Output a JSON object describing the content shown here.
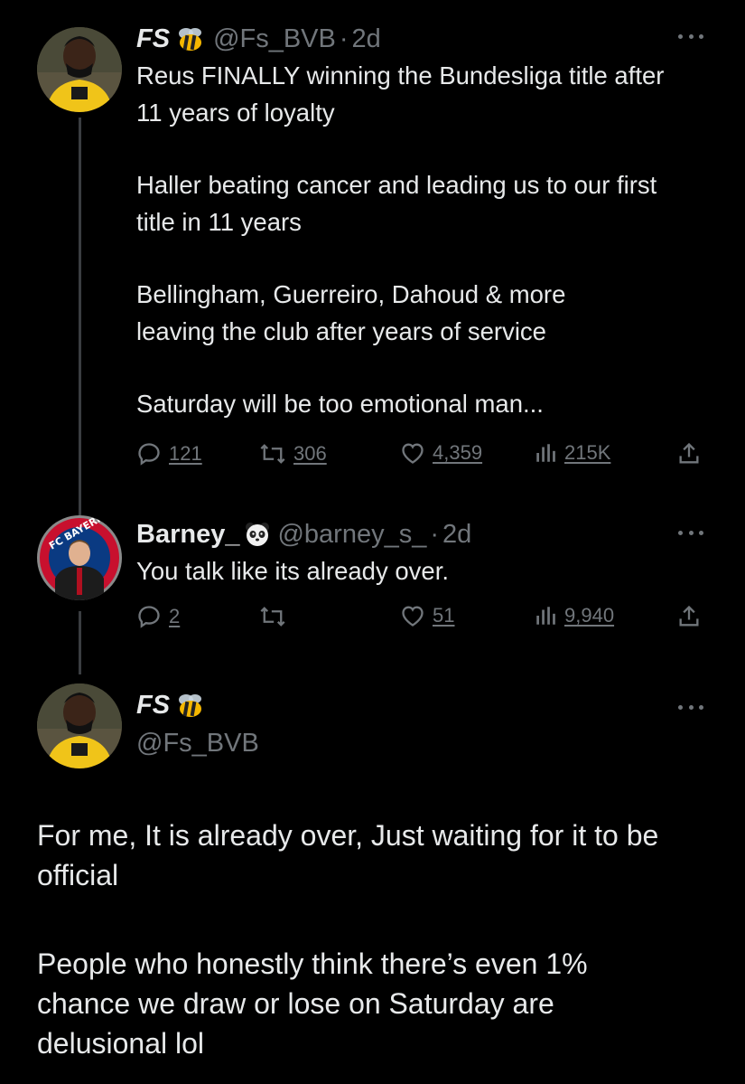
{
  "tweets": [
    {
      "display_name": "FS",
      "handle": "@Fs_BVB",
      "separator": "·",
      "time": "2d",
      "emoji": "bee-emoji",
      "paragraphs": [
        "Reus FINALLY winning the Bundesliga title after 11 years of loyalty",
        "Haller beating cancer and leading us to our first title in 11 years",
        "Bellingham, Guerreiro, Dahoud & more leaving the club after years of service",
        "Saturday will be too emotional man..."
      ],
      "stats": {
        "replies": "121",
        "retweets": "306",
        "likes": "4,359",
        "views": "215K"
      }
    },
    {
      "display_name": "Barney_",
      "handle": "@barney_s_",
      "separator": "·",
      "time": "2d",
      "emoji": "panda-emoji",
      "paragraphs": [
        "You talk like its already over."
      ],
      "stats": {
        "replies": "2",
        "retweets": "",
        "likes": "51",
        "views": "9,940"
      }
    },
    {
      "display_name": "FS",
      "handle": "@Fs_BVB",
      "emoji": "bee-emoji",
      "paragraphs": [
        "For me, It is already over, Just waiting for it to be official",
        "People who honestly think there’s even 1% chance we draw or lose on Saturday are delusional lol"
      ]
    }
  ],
  "colors": {
    "background": "#000000",
    "text": "#e7e9ea",
    "muted": "#71767b",
    "thread_line": "#3a3d41",
    "bvb_yellow": "#f5c518",
    "bayern_red": "#c8102e"
  }
}
